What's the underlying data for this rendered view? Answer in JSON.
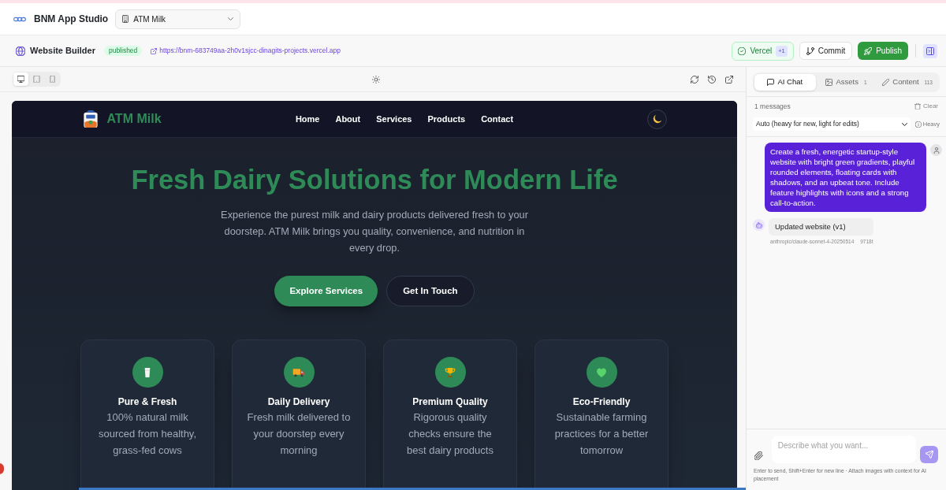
{
  "app_header": {
    "title": "BNM App Studio",
    "project_select": {
      "value": "ATM Milk"
    }
  },
  "builder_bar": {
    "title": "Website Builder",
    "status": "published",
    "url": "https://bnm-683749aa-2h0v1sjcc-dinagits-projects.vercel.app",
    "deployment": {
      "label": "Vercel",
      "count": "+1"
    },
    "buttons": [
      {
        "label": "Commit",
        "kind": "outline"
      },
      {
        "label": "Publish",
        "kind": "primary"
      }
    ],
    "panel_toggle": {
      "on": true
    }
  },
  "preview_toolbar": {
    "devices": [
      {
        "kind": "desktop",
        "selected": true
      },
      {
        "kind": "tablet",
        "selected": false
      },
      {
        "kind": "phone",
        "selected": false
      }
    ]
  },
  "site": {
    "brand": "ATM Milk",
    "nav": [
      "Home",
      "About",
      "Services",
      "Products",
      "Contact"
    ],
    "hero": {
      "title": "Fresh Dairy Solutions for Modern Life",
      "text": "Experience the purest milk and dairy products delivered fresh to your doorstep. ATM Milk brings you quality, convenience, and nutrition in every drop.",
      "buttons": [
        {
          "label": "Explore Services",
          "kind": "primary"
        },
        {
          "label": "Get In Touch",
          "kind": "secondary"
        }
      ]
    },
    "features": [
      {
        "title": "Pure & Fresh",
        "text": "100% natural milk sourced from healthy, grass-fed cows"
      },
      {
        "title": "Daily Delivery",
        "text": "Fresh milk delivered to your doorstep every morning"
      },
      {
        "title": "Premium Quality",
        "text": "Rigorous quality checks ensure the best dairy products"
      },
      {
        "title": "Eco-Friendly",
        "text": "Sustainable farming practices for a better tomorrow"
      }
    ]
  },
  "chat_panel": {
    "tabs": [
      {
        "label": "AI Chat",
        "selected": true
      },
      {
        "label": "Assets",
        "count": "1",
        "selected": false
      },
      {
        "label": "Content",
        "count": "113",
        "selected": false
      }
    ],
    "message_count": "1 messages",
    "clear_button": "Clear",
    "model_select": {
      "value": "Auto (heavy for new, light for edits)"
    },
    "mode": "Heavy",
    "messages": [
      {
        "kind": "user",
        "text": "Create a fresh, energetic startup-style website with bright green gradients, playful rounded elements, floating cards with shadows, and an upbeat tone. Include feature highlights with icons and a strong call-to-action."
      },
      {
        "kind": "assistant",
        "text": "Updated website (v1)",
        "model": "anthropic/claude-sonnet-4-20250514",
        "tokens": "9718t"
      }
    ],
    "composer": {
      "placeholder": "Describe what you want...",
      "send_disabled": true,
      "hint": "Enter to send, Shift+Enter for new line · Attach images with context for AI placement"
    }
  }
}
